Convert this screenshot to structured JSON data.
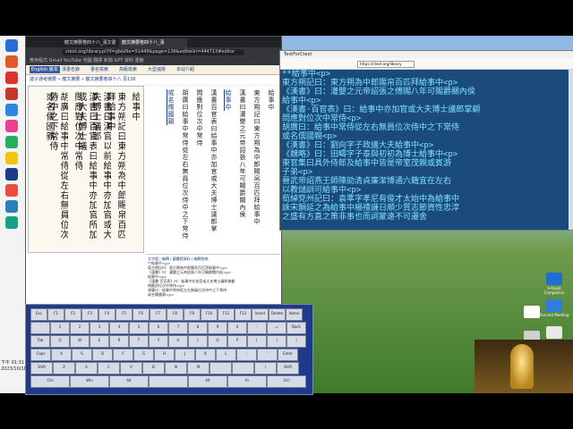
{
  "browser": {
    "tabs": [
      "龍文摘要卷四十八_漢文書",
      "龍文摘要卷四十八_漢"
    ],
    "url": "ctext.org/library.pl?if=gb&file=51449&page=136&editwiki=444713#editor",
    "bookmarks": "應用程式  Gmail  YouTube  地圖  翻譯  新聞  GPT  資料  書籤",
    "site_nav": [
      "English 版本",
      "漢書名錄",
      "書名檢索",
      "高級檢索",
      "大型遍檢",
      "本站介紹"
    ],
    "breadcrumb": "諸子通考摘要 » 龍文摘要 » 龍文摘要卷四十八 頁136",
    "page_no": "136",
    "scan_columns": [
      "給事中",
      "東方朔記曰東方朔為中郎賜帛百匹拜給事中",
      "漢書曰漢官以前給事中亦加官或大夫博士議郎",
      "漢書曰百官表曰給事中亦加官所加或大夫博士議",
      "問應對位次中常侍",
      "胡廣曰給事中常侍從左右無員位次侍中之下常侍",
      "或名儒國親"
    ],
    "transcript_columns": [
      "給事中",
      "東方朔記曰東方朔為中郎賜帛百匹拜給事中",
      "漢書曰灌嬰之元帝詔張八年可賜爵關內侯",
      "給事中",
      "漢書百官表曰給事中亦加官或大夫博士議郎掌",
      "問應對位次中常侍",
      "胡廣曰給事中常侍從左右無員位次侍中之下常侍",
      "或名儒國親"
    ],
    "cards_tabs": "文字版 | 編輯 | 圖書館資料 | 編輯指南",
    "cards_lines": [
      "**給事中<p>",
      "東方朔記曰：東方朔為中郎賜帛百匹拜給事中<p>",
      "《漢書》曰：灌嬰之元帝詔張八年可賜爵關內侯<p>",
      "給事中<p>",
      "《漢書·百官表》曰：給事中亦加官或大夫博士議郎掌顧",
      "問應對位次中常侍<p>",
      "胡廣曰：給事中常侍從左右無員位次侍中之下常侍",
      "或名儒國親<p>"
    ]
  },
  "editor": {
    "title": "TextForCtext",
    "url_field": "https://ctext.org/library",
    "lines": [
      "**給事中<p>",
      "東方朔記曰：東方朔為中郎賜帛百匹拜給事中<p>",
      "《漢書》曰：灌嬰之元帝詔張之傅賜八年可賜爵關內侯",
      "給事中<p>",
      "《漢書·百官表》曰：給事中亦加官或大夫博士議郎掌顧",
      "問應對位次中常侍<p>",
      "胡廣曰：給事中常侍從左右無員位次侍中之下常侍",
      "或名儒國親<p>",
      "《漢書》曰：劉向字子政議大夫給事中<p>",
      "《魏略》曰：田疇字子泰與初初為博士給事中<p>",
      "東官集曰具外侍郎及給事中皆是帝室茂親或賓游",
      "子弟<p>",
      "晉武帝詔燕王師陳劭清貞廉潔博通六籍宜在左右",
      "以教儲訓可給事中<p>",
      "荀綽兗州記曰：袁準字孝尼有俊才太始中為給事中",
      "誅宋韻延之為給事中楊禮謙日順少質志節資性忠淳",
      "之盛有方直之策非事也而詞蒙遠不可遷舍"
    ]
  },
  "keyboard": {
    "rows": [
      [
        "Esc",
        "F1",
        "F2",
        "F3",
        "F4",
        "F5",
        "F6",
        "F7",
        "F8",
        "F9",
        "F10",
        "F11",
        "F12",
        "Insert",
        "Delete",
        "Home"
      ],
      [
        "`",
        "1",
        "2",
        "3",
        "4",
        "5",
        "6",
        "7",
        "8",
        "9",
        "0",
        "-",
        "=",
        "Back"
      ],
      [
        "Tab",
        "Q",
        "W",
        "E",
        "R",
        "T",
        "Y",
        "U",
        "I",
        "O",
        "P",
        "[",
        "]",
        "\\"
      ],
      [
        "Caps",
        "A",
        "S",
        "D",
        "F",
        "G",
        "H",
        "J",
        "K",
        "L",
        ";",
        "'",
        "Enter"
      ],
      [
        "Shift",
        "Z",
        "X",
        "C",
        "V",
        "B",
        "N",
        "M",
        ",",
        ".",
        "/",
        "Shift"
      ],
      [
        "Ctrl",
        "Win",
        "Alt",
        "",
        "Alt",
        "Fn",
        "Ctrl"
      ]
    ]
  },
  "taskbar": {
    "time": "下午 01:31",
    "date": "2023/10/18"
  },
  "desktop_icons": [
    {
      "label": "V-Assist Companion"
    },
    {
      "label": "Tencent Meeting"
    },
    {
      "label": "畫圖"
    }
  ],
  "colors": {
    "editor_bg": "#1b4b7a",
    "editor_text": "#7fe3ff",
    "keyboard_bg": "#1e3a8a"
  }
}
